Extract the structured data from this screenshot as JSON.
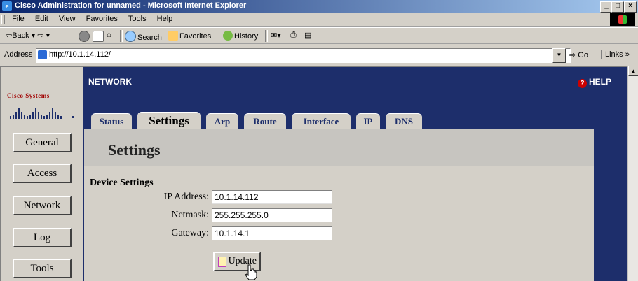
{
  "window": {
    "title": "Cisco Administration for unnamed - Microsoft Internet Explorer",
    "controls": [
      "_",
      "□",
      "×"
    ]
  },
  "menu": [
    "File",
    "Edit",
    "View",
    "Favorites",
    "Tools",
    "Help"
  ],
  "toolbar": {
    "back": "Back",
    "search": "Search",
    "favorites": "Favorites",
    "history": "History"
  },
  "address": {
    "label": "Address",
    "url": "http://10.1.14.112/",
    "go": "Go",
    "links": "Links »"
  },
  "page": {
    "section_title": "NETWORK",
    "help": "HELP",
    "logo": "Cisco Systems",
    "nav": [
      "General",
      "Access",
      "Network",
      "Log",
      "Tools"
    ],
    "tabs": [
      "Status",
      "Settings",
      "Arp",
      "Route",
      "Interface",
      "IP",
      "DNS"
    ],
    "active_tab": "Settings",
    "heading": "Settings",
    "subheading": "Device Settings",
    "fields": [
      {
        "label": "IP Address:",
        "value": "10.1.14.112"
      },
      {
        "label": "Netmask:",
        "value": "255.255.255.0"
      },
      {
        "label": "Gateway:",
        "value": "10.1.14.1"
      }
    ],
    "update": "Update"
  }
}
